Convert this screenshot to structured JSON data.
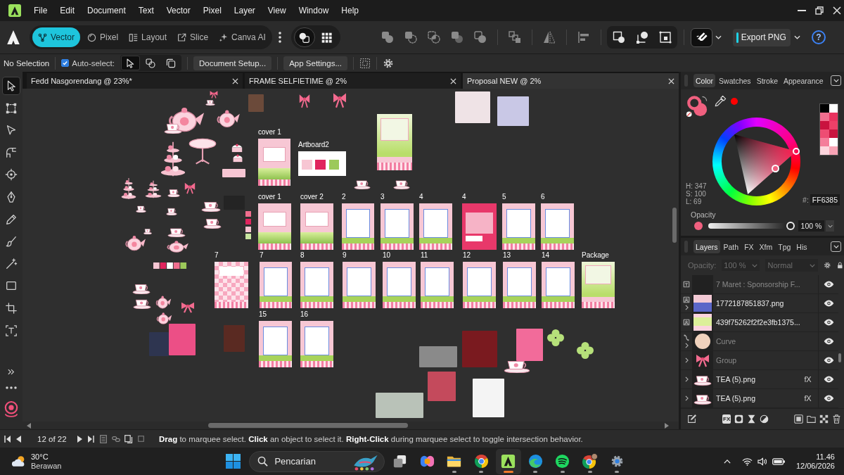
{
  "menu": [
    "File",
    "Edit",
    "Document",
    "Text",
    "Vector",
    "Pixel",
    "Layer",
    "View",
    "Window",
    "Help"
  ],
  "personas": [
    {
      "label": "Vector",
      "selected": true
    },
    {
      "label": "Pixel",
      "selected": false
    },
    {
      "label": "Layout",
      "selected": false
    },
    {
      "label": "Slice",
      "selected": false
    },
    {
      "label": "Canva AI",
      "selected": false
    }
  ],
  "view_modes": [
    {
      "selected": true
    },
    {
      "selected": false
    }
  ],
  "snapping": {
    "on": true
  },
  "export_button": "Export PNG",
  "help_button": "?",
  "context_bar": {
    "selection": "No Selection",
    "auto_select": {
      "label": "Auto-select:",
      "checked": true
    },
    "select_modes": [
      {
        "selected": true
      },
      {
        "selected": false
      },
      {
        "selected": false
      }
    ],
    "buttons": [
      "Document Setup...",
      "App Settings..."
    ]
  },
  "tools": [
    {
      "selected": true
    },
    {
      "selected": false
    },
    {
      "selected": false
    },
    {
      "selected": false
    },
    {
      "selected": false
    },
    {
      "selected": false
    },
    {
      "selected": false
    },
    {
      "selected": false
    },
    {
      "selected": false
    },
    {
      "selected": false
    },
    {
      "selected": false
    },
    {
      "selected": false
    }
  ],
  "document_tabs": [
    {
      "title": "Fedd Nasgorendang @ 23%*",
      "selected": false
    },
    {
      "title": "FRAME SELFIETIME @ 2%",
      "selected": false
    },
    {
      "title": "Proposal NEW @ 2%",
      "selected": true
    }
  ],
  "canvas": {
    "artboards": [
      {
        "label": "cover 1"
      },
      {
        "label": "Artboard2"
      },
      {
        "label": "cover 1"
      },
      {
        "label": "cover 2"
      },
      {
        "label": "2"
      },
      {
        "label": "3"
      },
      {
        "label": "4"
      },
      {
        "label": "4"
      },
      {
        "label": "5"
      },
      {
        "label": "6"
      },
      {
        "label": "7"
      },
      {
        "label": "7"
      },
      {
        "label": "8"
      },
      {
        "label": "9"
      },
      {
        "label": "10"
      },
      {
        "label": "11"
      },
      {
        "label": "12"
      },
      {
        "label": "13"
      },
      {
        "label": "14"
      },
      {
        "label": "Package"
      },
      {
        "label": "15"
      },
      {
        "label": "16"
      }
    ]
  },
  "color_panel": {
    "tabs": [
      {
        "label": "Color",
        "selected": true
      },
      {
        "label": "Swatches",
        "selected": false
      },
      {
        "label": "Stroke",
        "selected": false
      },
      {
        "label": "Appearance",
        "selected": false
      }
    ],
    "swatches": [
      {
        "color": "#000000"
      },
      {
        "color": "#ffffff"
      },
      {
        "color": "#f06e8e"
      },
      {
        "color": "#e8335f"
      },
      {
        "color": "#c9123f"
      },
      {
        "color": "#ec4068"
      },
      {
        "color": "#ee4d73"
      },
      {
        "color": "#c8153f"
      },
      {
        "color": "#f47d9a"
      },
      {
        "color": "#ffffff"
      },
      {
        "color": "#fdd5dd"
      },
      {
        "color": "#f8a4b5"
      }
    ],
    "hsl": [
      "H: 347",
      "S: 100",
      "L: 69"
    ],
    "hex_label": "#:",
    "hex": "FF6385",
    "opacity_label": "Opacity",
    "opacity": {
      "level": 1,
      "value": "100 %"
    }
  },
  "layers_panel": {
    "tabs": [
      {
        "label": "Layers",
        "selected": true
      },
      {
        "label": "Path",
        "selected": false
      },
      {
        "label": "FX",
        "selected": false
      },
      {
        "label": "Xfm",
        "selected": false
      },
      {
        "label": "Tpg",
        "selected": false
      },
      {
        "label": "His",
        "selected": false
      }
    ],
    "opacity_label": "Opacity:",
    "opacity_value": "100 %",
    "blend_mode": "Normal",
    "options_disabled": true,
    "layers": [
      {
        "name": "7 Maret : Sponsorship F...",
        "kind": "text",
        "expandable": false,
        "dimmed": true,
        "visible": true
      },
      {
        "name": "1772187851837.png",
        "kind": "image",
        "thumbnail": {
          "kind": "photo"
        },
        "expandable": true,
        "dimmed": false,
        "visible": true
      },
      {
        "name": "439f75262f2f2e3fb1375...",
        "kind": "image",
        "thumbnail": {
          "kind": "photo"
        },
        "expandable": false,
        "dimmed": false,
        "visible": true
      },
      {
        "name": "Curve",
        "kind": "curve",
        "thumbnail": {
          "kind": "portrait"
        },
        "expandable": true,
        "dimmed": true,
        "visible": true
      },
      {
        "name": "Group",
        "thumbnail": {
          "kind": "bow"
        },
        "expandable": true,
        "dimmed": true,
        "visible": true
      },
      {
        "name": "TEA (5).png",
        "thumbnail": {
          "kind": "teacup"
        },
        "effect": "fX",
        "expandable": true,
        "dimmed": false,
        "visible": true
      },
      {
        "name": "TEA (5).png",
        "thumbnail": {
          "kind": "teacup"
        },
        "effect": "fX",
        "expandable": true,
        "dimmed": false,
        "visible": true
      }
    ],
    "effects_button": "FX"
  },
  "status_bar": {
    "page": "12 of 22",
    "hint": "**Drag** to marquee select. **Click** an object to select it. **Right-Click** during marquee select to toggle intersection behavior."
  },
  "taskbar": {
    "weather": {
      "temperature": "30°C",
      "condition": "Berawan"
    },
    "search": {
      "placeholder": "Pencarian"
    },
    "apps": [
      {
        "kind": "task-view",
        "running": false,
        "selected": false
      },
      {
        "kind": "assistant",
        "running": false,
        "selected": false
      },
      {
        "kind": "files",
        "running": true,
        "selected": false
      },
      {
        "kind": "browser",
        "running": true,
        "selected": false
      },
      {
        "kind": "design-app",
        "running": true,
        "selected": true
      },
      {
        "kind": "web-browser",
        "running": true,
        "selected": false
      },
      {
        "kind": "music",
        "running": true,
        "selected": false
      },
      {
        "kind": "browser-profile",
        "running": true,
        "selected": false
      },
      {
        "kind": "settings",
        "running": true,
        "selected": false
      }
    ],
    "clock": {
      "time": "11.46",
      "date": "12/06/2026"
    }
  }
}
